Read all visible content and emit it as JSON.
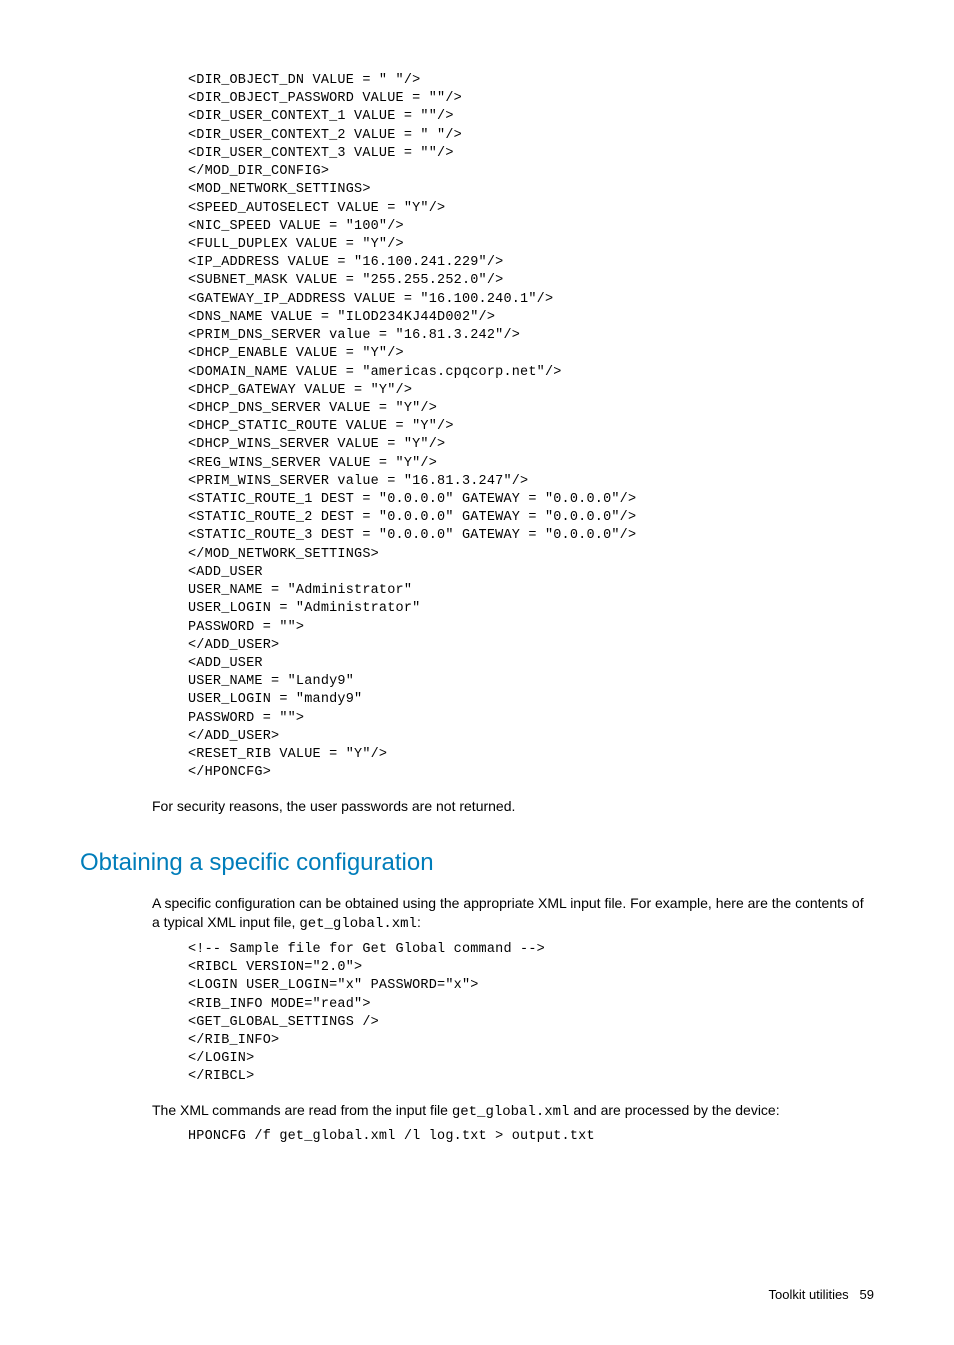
{
  "codeBlock1": "<DIR_OBJECT_DN VALUE = \" \"/>\n<DIR_OBJECT_PASSWORD VALUE = \"\"/>\n<DIR_USER_CONTEXT_1 VALUE = \"\"/>\n<DIR_USER_CONTEXT_2 VALUE = \" \"/>\n<DIR_USER_CONTEXT_3 VALUE = \"\"/>\n</MOD_DIR_CONFIG>\n<MOD_NETWORK_SETTINGS>\n<SPEED_AUTOSELECT VALUE = \"Y\"/>\n<NIC_SPEED VALUE = \"100\"/>\n<FULL_DUPLEX VALUE = \"Y\"/>\n<IP_ADDRESS VALUE = \"16.100.241.229\"/>\n<SUBNET_MASK VALUE = \"255.255.252.0\"/>\n<GATEWAY_IP_ADDRESS VALUE = \"16.100.240.1\"/>\n<DNS_NAME VALUE = \"ILOD234KJ44D002\"/>\n<PRIM_DNS_SERVER value = \"16.81.3.242\"/>\n<DHCP_ENABLE VALUE = \"Y\"/>\n<DOMAIN_NAME VALUE = \"americas.cpqcorp.net\"/>\n<DHCP_GATEWAY VALUE = \"Y\"/>\n<DHCP_DNS_SERVER VALUE = \"Y\"/>\n<DHCP_STATIC_ROUTE VALUE = \"Y\"/>\n<DHCP_WINS_SERVER VALUE = \"Y\"/>\n<REG_WINS_SERVER VALUE = \"Y\"/>\n<PRIM_WINS_SERVER value = \"16.81.3.247\"/>\n<STATIC_ROUTE_1 DEST = \"0.0.0.0\" GATEWAY = \"0.0.0.0\"/>\n<STATIC_ROUTE_2 DEST = \"0.0.0.0\" GATEWAY = \"0.0.0.0\"/>\n<STATIC_ROUTE_3 DEST = \"0.0.0.0\" GATEWAY = \"0.0.0.0\"/>\n</MOD_NETWORK_SETTINGS>\n<ADD_USER\nUSER_NAME = \"Administrator\"\nUSER_LOGIN = \"Administrator\"\nPASSWORD = \"\">\n</ADD_USER>\n<ADD_USER\nUSER_NAME = \"Landy9\"\nUSER_LOGIN = \"mandy9\"\nPASSWORD = \"\">\n</ADD_USER>\n<RESET_RIB VALUE = \"Y\"/>\n</HPONCFG>",
  "para1": "For security reasons, the user passwords are not returned.",
  "heading1": "Obtaining a specific configuration",
  "para2a": "A specific configuration can be obtained using the appropriate XML input file. For example, here are the contents of a typical XML input file, ",
  "para2code": "get_global.xml",
  "para2b": ":",
  "codeBlock2": "<!-- Sample file for Get Global command -->\n<RIBCL VERSION=\"2.0\">\n<LOGIN USER_LOGIN=\"x\" PASSWORD=\"x\">\n<RIB_INFO MODE=\"read\">\n<GET_GLOBAL_SETTINGS />\n</RIB_INFO>\n</LOGIN>\n</RIBCL>",
  "para3a": "The XML commands are read from the input file ",
  "para3code": "get_global.xml",
  "para3b": " and are processed by the device:",
  "codeBlock3": "HPONCFG /f get_global.xml /l log.txt > output.txt",
  "footerLabel": "Toolkit utilities",
  "footerPage": "59"
}
